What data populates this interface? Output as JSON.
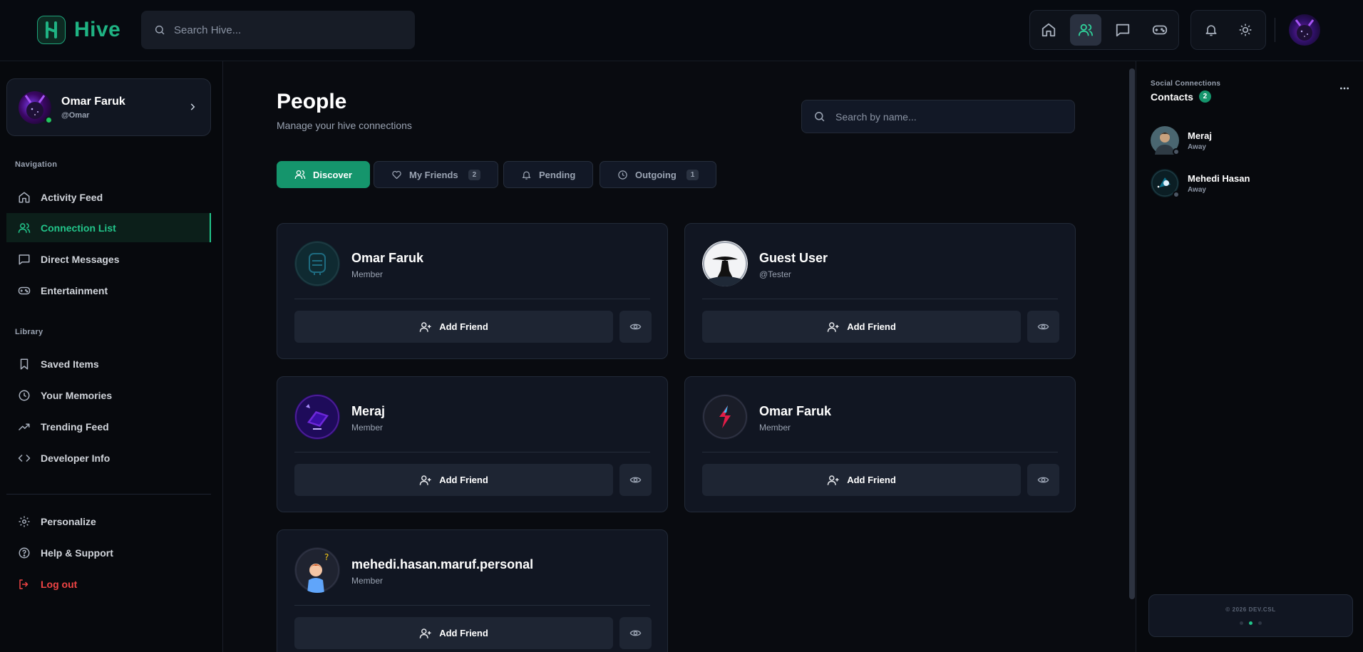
{
  "app": {
    "name": "Hive",
    "search_placeholder": "Search Hive...",
    "brand_color": "#1fb383"
  },
  "topnav": {
    "items": [
      {
        "icon": "home-icon",
        "active": false
      },
      {
        "icon": "users-icon",
        "active": true
      },
      {
        "icon": "message-icon",
        "active": false
      },
      {
        "icon": "gamepad-icon",
        "active": false
      }
    ],
    "utilities": [
      "bell-icon",
      "sun-icon"
    ]
  },
  "profile": {
    "name": "Omar Faruk",
    "handle": "@Omar",
    "status": "online"
  },
  "sidebar": {
    "nav_label": "Navigation",
    "nav_items": [
      {
        "label": "Activity Feed",
        "icon": "home-icon"
      },
      {
        "label": "Connection List",
        "icon": "users-icon",
        "active": true
      },
      {
        "label": "Direct Messages",
        "icon": "message-icon"
      },
      {
        "label": "Entertainment",
        "icon": "gamepad-icon"
      }
    ],
    "library_label": "Library",
    "library_items": [
      {
        "label": "Saved Items",
        "icon": "bookmark-icon"
      },
      {
        "label": "Your Memories",
        "icon": "clock-icon"
      },
      {
        "label": "Trending Feed",
        "icon": "trending-icon"
      },
      {
        "label": "Developer Info",
        "icon": "code-icon"
      }
    ],
    "bottom_items": [
      {
        "label": "Personalize",
        "icon": "gear-icon"
      },
      {
        "label": "Help & Support",
        "icon": "help-icon"
      },
      {
        "label": "Log out",
        "icon": "logout-icon",
        "danger": true
      }
    ]
  },
  "main": {
    "title": "People",
    "subtitle": "Manage your hive connections",
    "search_placeholder": "Search by name...",
    "tabs": [
      {
        "label": "Discover",
        "active": true
      },
      {
        "label": "My Friends",
        "count": "2"
      },
      {
        "label": "Pending"
      },
      {
        "label": "Outgoing",
        "count": "1"
      }
    ],
    "add_friend_label": "Add Friend",
    "people": [
      {
        "name": "Omar Faruk",
        "role": "Member"
      },
      {
        "name": "Guest User",
        "role": "@Tester"
      },
      {
        "name": "Meraj",
        "role": "Member"
      },
      {
        "name": "Omar Faruk",
        "role": "Member"
      },
      {
        "name": "mehedi.hasan.maruf.personal",
        "role": "Member"
      }
    ]
  },
  "rightpanel": {
    "label": "Social Connections",
    "title": "Contacts",
    "count": "2",
    "contacts": [
      {
        "name": "Meraj",
        "status": "Away"
      },
      {
        "name": "Mehedi Hasan",
        "status": "Away"
      }
    ],
    "footer": "© 2026 DEV.CSL"
  }
}
